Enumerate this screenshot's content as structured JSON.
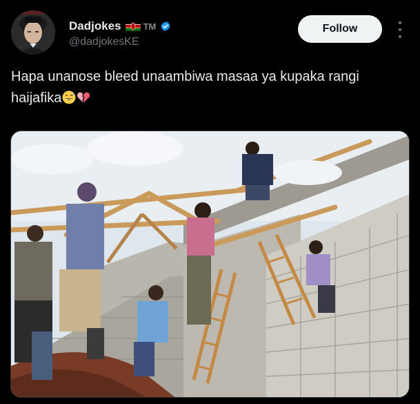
{
  "tweet": {
    "display_name": "Dadjokes",
    "trademark": "TM",
    "handle": "@dadjokesKE",
    "text": "Hapa unanose bleed unaambiwa masaa ya kupaka rangi haijafika",
    "emojis": [
      "grinning-sweat-face-emoji",
      "broken-heart-emoji"
    ]
  },
  "actions": {
    "follow_label": "Follow"
  },
  "colors": {
    "background": "#000000",
    "verified": "#1d9bf0",
    "follow_bg": "#eff3f4"
  }
}
